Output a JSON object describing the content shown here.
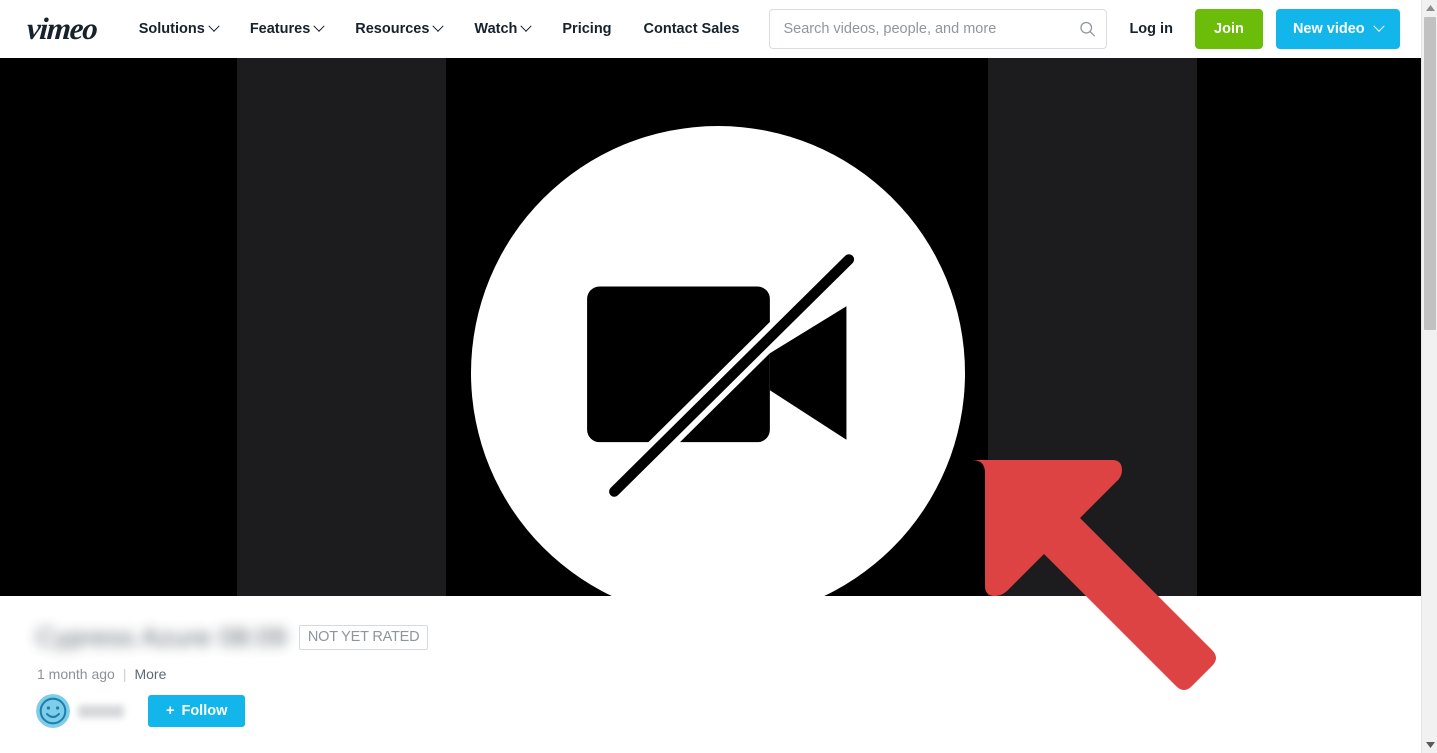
{
  "header": {
    "logo": "vimeo",
    "nav_items": [
      {
        "label": "Solutions",
        "has_caret": true
      },
      {
        "label": "Features",
        "has_caret": true
      },
      {
        "label": "Resources",
        "has_caret": true
      },
      {
        "label": "Watch",
        "has_caret": true
      },
      {
        "label": "Pricing",
        "has_caret": false
      },
      {
        "label": "Contact Sales",
        "has_caret": false
      }
    ],
    "search": {
      "placeholder": "Search videos, people, and more",
      "value": "",
      "icon": "search-icon"
    },
    "login_label": "Log in",
    "join_label": "Join",
    "new_video_label": "New video"
  },
  "video": {
    "state_icon": "video-off-icon",
    "background_color": "#000000",
    "band_color": "#1c1c1f",
    "annotation": {
      "type": "arrow",
      "color": "#dd4343",
      "direction": "up-left"
    }
  },
  "meta": {
    "title_redacted": "Cypress Azure  08:09",
    "rating_badge": "NOT YET RATED",
    "uploaded": "1 month ago",
    "separator": "|",
    "more_label": "More",
    "owner_avatar_icon": "smiley-avatar-icon",
    "owner_name_redacted": "",
    "follow_label": "Follow",
    "follow_plus": "+"
  },
  "scrollbar": {
    "up_icon": "chevron-up-icon",
    "down_icon": "chevron-down-icon",
    "thumb_color": "#c1c1c1"
  },
  "colors": {
    "join_green": "#6cbd0a",
    "vimeo_blue": "#12b6ea",
    "arrow_red": "#dd4343",
    "text_dark": "#16222c"
  }
}
